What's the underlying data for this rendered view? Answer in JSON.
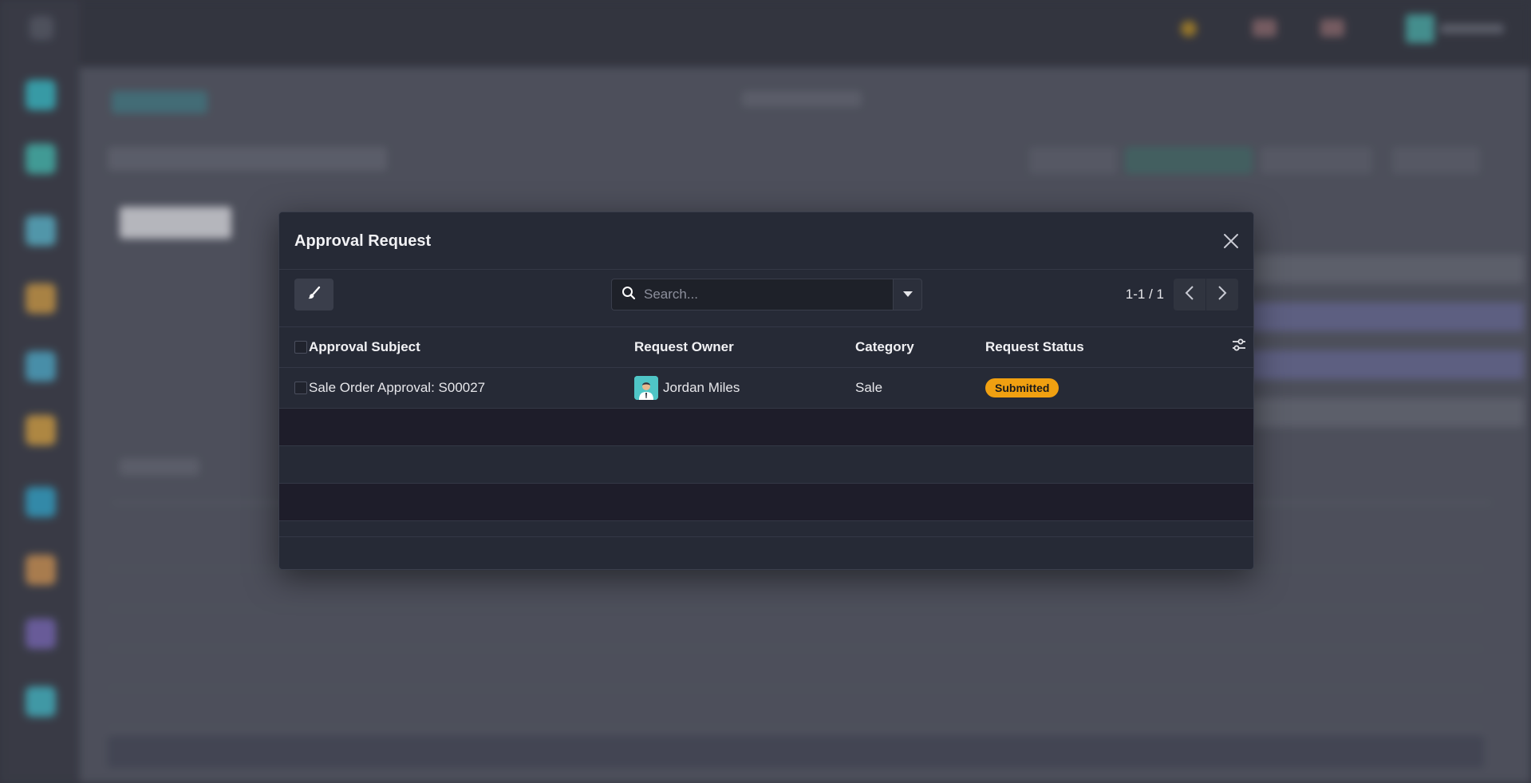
{
  "dialog": {
    "title": "Approval Request",
    "close_icon": "close-icon"
  },
  "toolbar": {
    "clear_icon": "brush-icon",
    "search_placeholder": "Search...",
    "search_icon": "search-icon",
    "filter_toggle_icon": "caret-down-icon",
    "pager_value": "1-1 / 1",
    "prev_icon": "chevron-left-icon",
    "next_icon": "chevron-right-icon"
  },
  "table": {
    "columns": [
      "Approval Subject",
      "Request Owner",
      "Category",
      "Request Status"
    ],
    "settings_icon": "sliders-icon",
    "rows": [
      {
        "subject": "Sale Order Approval: S00027",
        "owner": "Jordan Miles",
        "category": "Sale",
        "status": "Submitted"
      }
    ]
  },
  "colors": {
    "status_submitted": "#f0a011",
    "dialog_bg": "#262a36",
    "empty_row_dark": "#1e1d2a"
  }
}
